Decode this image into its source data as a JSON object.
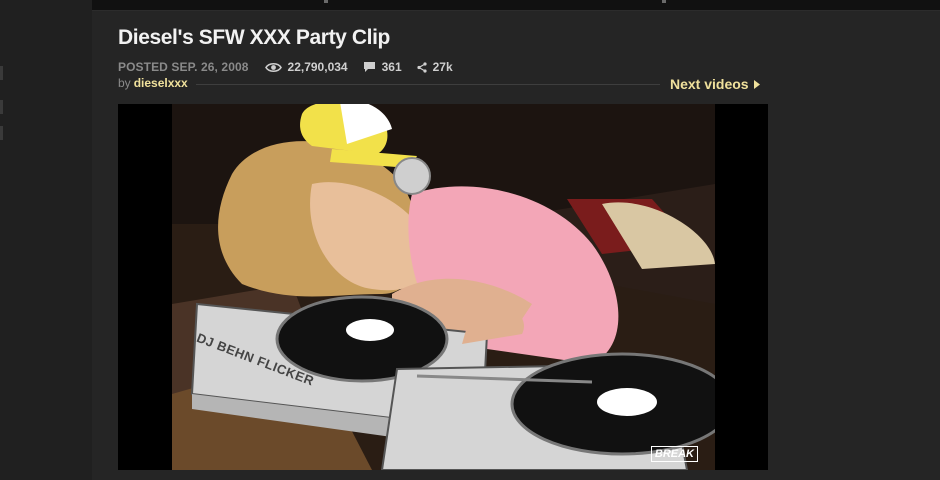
{
  "video": {
    "title": "Diesel's SFW XXX Party Clip",
    "posted": "POSTED SEP. 26, 2008",
    "views": "22,790,034",
    "comments": "361",
    "shares": "27k",
    "by_label": "by",
    "author": "dieselxxx",
    "turntable_text": "DJ BEHN FLICKER",
    "watermark": "BREAK"
  },
  "nav": {
    "next_videos": "Next videos"
  },
  "colors": {
    "accent": "#f0e19c",
    "background": "#1a1a1a",
    "panel": "#252525"
  },
  "icons": [
    "eye-icon",
    "comment-icon",
    "share-icon",
    "play-arrow-icon"
  ]
}
